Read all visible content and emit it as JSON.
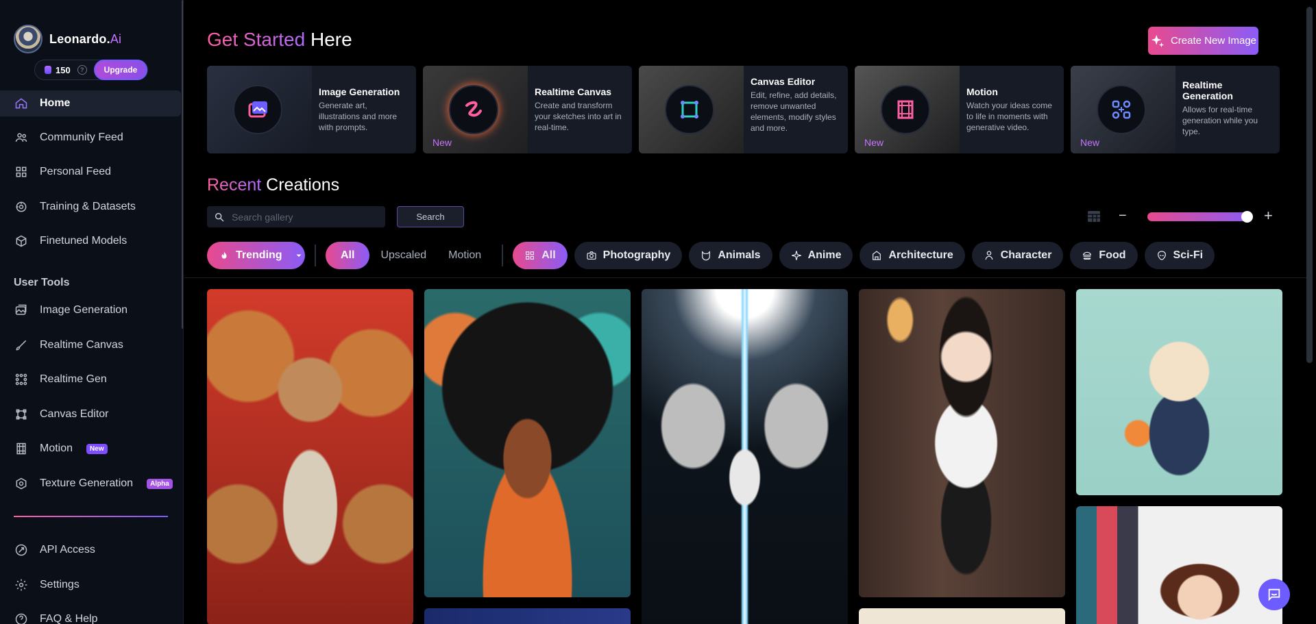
{
  "brand": {
    "name": "Leonardo.",
    "name_suffix": "Ai"
  },
  "account": {
    "credits": "150",
    "help": "?",
    "upgrade_label": "Upgrade"
  },
  "nav": {
    "main": [
      {
        "label": "Home",
        "icon": "home-icon"
      },
      {
        "label": "Community Feed",
        "icon": "users-icon"
      },
      {
        "label": "Personal Feed",
        "icon": "grid-icon"
      },
      {
        "label": "Training & Datasets",
        "icon": "training-icon"
      },
      {
        "label": "Finetuned Models",
        "icon": "cube-icon"
      }
    ],
    "user_tools_title": "User Tools",
    "tools": [
      {
        "label": "Image Generation",
        "icon": "image-icon"
      },
      {
        "label": "Realtime Canvas",
        "icon": "brush-icon"
      },
      {
        "label": "Realtime Gen",
        "icon": "dots-grid-icon"
      },
      {
        "label": "Canvas Editor",
        "icon": "crop-icon"
      },
      {
        "label": "Motion",
        "icon": "film-icon",
        "badge": "New"
      },
      {
        "label": "Texture Generation",
        "icon": "texture-icon",
        "badge": "Alpha"
      }
    ],
    "bottom": [
      {
        "label": "API Access",
        "icon": "api-icon"
      },
      {
        "label": "Settings",
        "icon": "gear-icon"
      },
      {
        "label": "FAQ & Help",
        "icon": "help-icon"
      }
    ]
  },
  "header": {
    "title_accent": "Get Started",
    "title_rest": " Here",
    "create_label": "Create New Image"
  },
  "feature_cards": [
    {
      "title": "Image Generation",
      "desc": "Generate art, illustrations and more with prompts.",
      "badge": "",
      "icon": "image-gen-icon"
    },
    {
      "title": "Realtime Canvas",
      "desc": "Create and transform your sketches into art in real-time.",
      "badge": "New",
      "icon": "squiggle-icon"
    },
    {
      "title": "Canvas Editor",
      "desc": "Edit, refine, add details, remove unwanted elements, modify styles and more.",
      "badge": "",
      "icon": "canvas-square-icon"
    },
    {
      "title": "Motion",
      "desc": "Watch your ideas come to life in moments with generative video.",
      "badge": "New",
      "icon": "film-strip-icon"
    },
    {
      "title": "Realtime Generation",
      "desc": "Allows for real-time generation while you type.",
      "badge": "New",
      "icon": "realtime-dots-icon"
    }
  ],
  "recent": {
    "title_accent": "Recent",
    "title_rest": " Creations",
    "search_placeholder": "Search gallery",
    "search_button": "Search"
  },
  "filters": {
    "trending_label": "Trending",
    "type_tabs": [
      "All",
      "Upscaled",
      "Motion"
    ],
    "categories": [
      {
        "label": "All",
        "icon": "grid-icon"
      },
      {
        "label": "Photography",
        "icon": "camera-icon"
      },
      {
        "label": "Animals",
        "icon": "cat-icon"
      },
      {
        "label": "Anime",
        "icon": "star-icon"
      },
      {
        "label": "Architecture",
        "icon": "building-icon"
      },
      {
        "label": "Character",
        "icon": "person-icon"
      },
      {
        "label": "Food",
        "icon": "burger-icon"
      },
      {
        "label": "Sci-Fi",
        "icon": "alien-icon"
      }
    ]
  },
  "gallery_zoom_level": 0.9,
  "colors": {
    "accent_pink": "#e84a8e",
    "accent_purple": "#8b5cf6",
    "sidebar_bg": "#0b0f17"
  }
}
